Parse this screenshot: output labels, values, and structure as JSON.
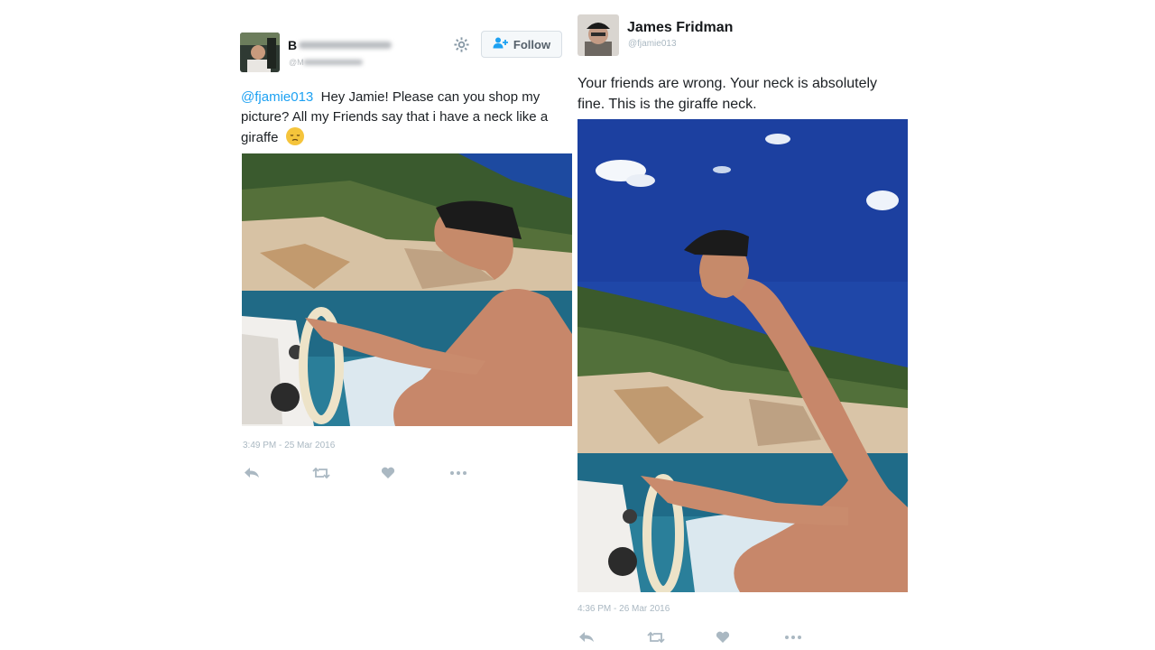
{
  "left_tweet": {
    "author_name": "B",
    "handle": "@M",
    "follow_label": "Follow",
    "mention": "@fjamie013",
    "text": "Hey Jamie! Please can you shop my picture? All my Friends say that i have a neck like a giraffe",
    "timestamp": "3:49 PM - 25 Mar 2016",
    "icons": [
      "gear-icon",
      "add-user-icon",
      "reply-icon",
      "retweet-icon",
      "like-icon",
      "more-icon",
      "sad-face-emoji"
    ]
  },
  "right_tweet": {
    "author_name": "James Fridman",
    "handle": "@fjamie013",
    "text": "Your friends are wrong. Your neck is absolutely fine. This is the giraffe neck.",
    "timestamp": "4:36 PM - 26 Mar 2016",
    "icons": [
      "reply-icon",
      "retweet-icon",
      "like-icon",
      "more-icon"
    ]
  },
  "colors": {
    "link": "#1da1f2",
    "muted": "#aab8c2",
    "text": "#14171a"
  }
}
